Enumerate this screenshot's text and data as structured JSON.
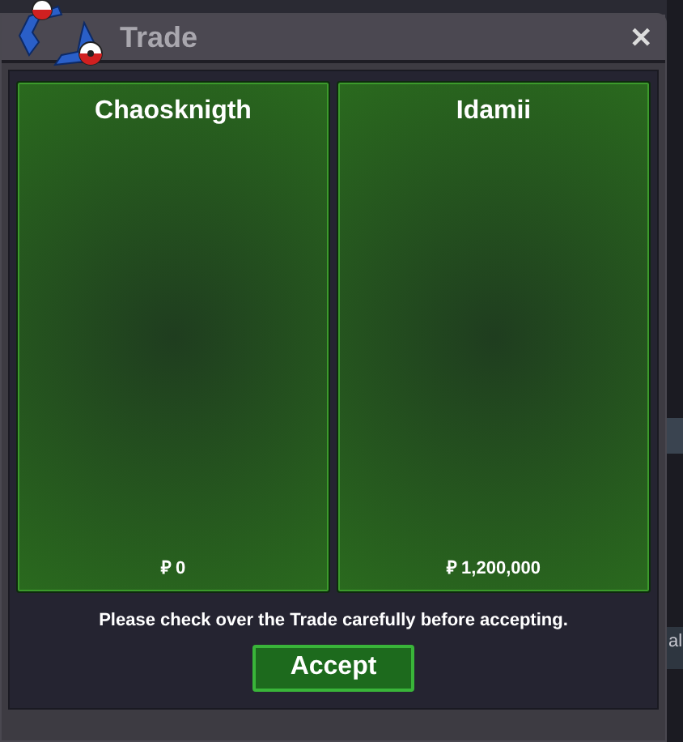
{
  "window": {
    "title": "Trade",
    "close": "✕"
  },
  "offers": [
    {
      "player": "Chaosknigth",
      "money": "₽ 0"
    },
    {
      "player": "Idamii",
      "money": "₽ 1,200,000"
    }
  ],
  "message": "Please check over the Trade carefully before accepting.",
  "buttons": [
    "Accept"
  ],
  "background_text": "al"
}
